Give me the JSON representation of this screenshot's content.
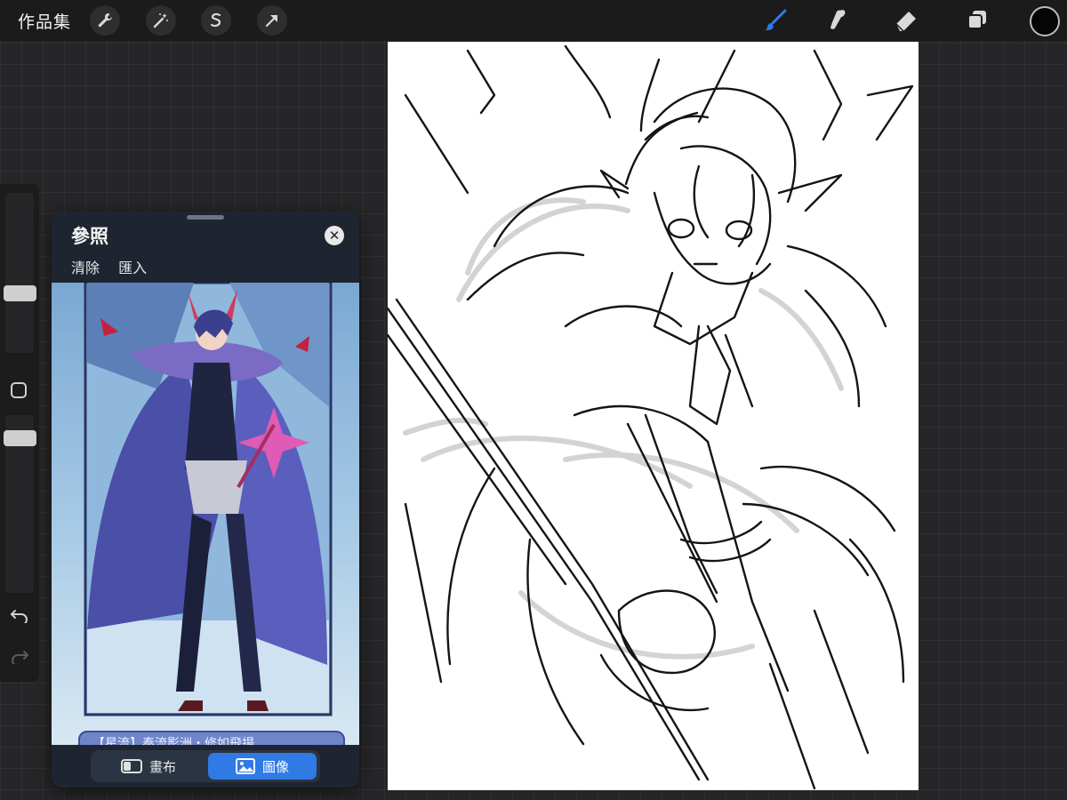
{
  "toolbar": {
    "gallery_label": "作品集",
    "left_tools": [
      "wrench-icon",
      "magic-wand-icon",
      "selection-icon",
      "transform-arrow-icon"
    ],
    "right_tools": [
      "brush-icon",
      "smudge-icon",
      "eraser-icon",
      "layers-icon"
    ],
    "active_tool": "brush-icon",
    "active_color": "#000000",
    "accent_color": "#2f7ae5"
  },
  "sidebar": {
    "undo_icon": "undo-icon",
    "redo_icon": "redo-icon",
    "modify_icon": "square-modify-icon"
  },
  "reference": {
    "title": "參照",
    "clear_label": "清除",
    "import_label": "匯入",
    "close_icon": "close-icon",
    "caption": "【星流】奉流影洲・修如飛揚",
    "segment": {
      "canvas_label": "畫布",
      "image_label": "圖像",
      "selected": "圖像"
    }
  }
}
